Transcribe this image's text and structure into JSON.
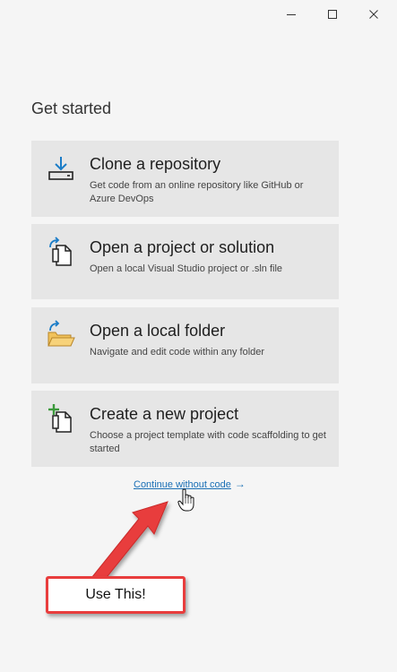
{
  "window": {
    "minimize_icon": "minimize-icon",
    "maximize_icon": "maximize-icon",
    "close_icon": "close-icon"
  },
  "heading": "Get started",
  "cards": [
    {
      "title": "Clone a repository",
      "description": "Get code from an online repository like GitHub or Azure DevOps",
      "icon": "clone-download-icon"
    },
    {
      "title": "Open a project or solution",
      "description": "Open a local Visual Studio project or .sln file",
      "icon": "open-project-icon"
    },
    {
      "title": "Open a local folder",
      "description": "Navigate and edit code within any folder",
      "icon": "open-folder-icon"
    },
    {
      "title": "Create a new project",
      "description": "Choose a project template with code scaffolding to get started",
      "icon": "new-project-icon"
    }
  ],
  "continue_link": {
    "label": "Continue without code",
    "arrow": "→"
  },
  "annotation": {
    "callout_text": "Use This!",
    "color": "#e83d3d"
  },
  "colors": {
    "background": "#f5f5f5",
    "card": "#e6e6e6",
    "link": "#1a6fb5",
    "accent_blue": "#1a7cc7",
    "green": "#3c9a3c",
    "folder": "#f1c25a"
  }
}
